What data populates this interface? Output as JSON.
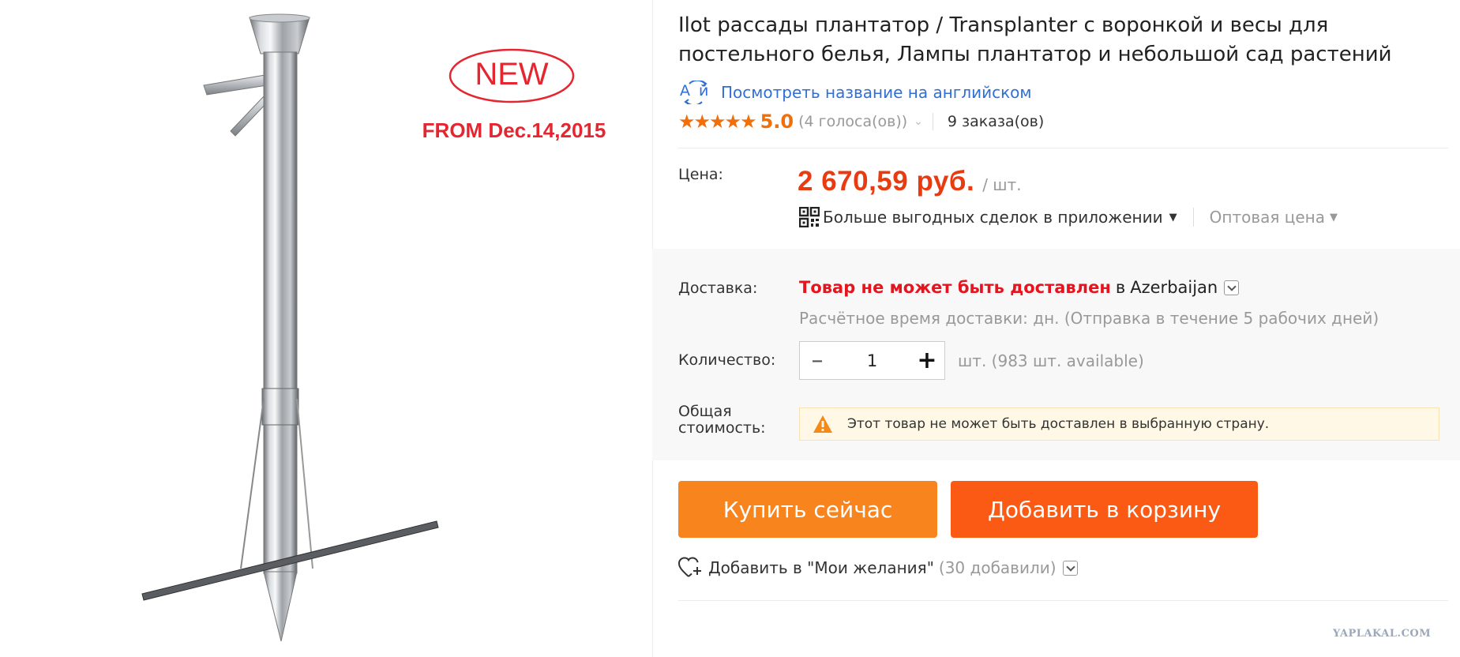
{
  "image": {
    "badge_new": "NEW",
    "badge_from": "FROM Dec.14,2015"
  },
  "product": {
    "title": "Ilot рассады плантатор / Transplanter с воронкой и весы для постельного белья, Лампы плантатор и небольшой сад растений",
    "translate_link": "Посмотреть название на английском",
    "translate_icon_text": "A",
    "translate_icon_text2": "й",
    "stars": "★★★★★",
    "rating": "5.0",
    "votes": "(4 голоса(ов))",
    "orders": "9 заказа(ов)"
  },
  "price": {
    "label": "Цена:",
    "value": "2 670,59 руб.",
    "unit": "/ шт.",
    "deals_text": "Больше выгодных сделок в приложении",
    "wholesale": "Оптовая цена"
  },
  "shipping": {
    "label": "Доставка:",
    "not_delivered": "Товар не может быть доставлен",
    "in_word": "в",
    "country": "Azerbaijan",
    "time_text": "Расчётное время доставки: дн. (Отправка в течение 5 рабочих дней)"
  },
  "quantity": {
    "label": "Количество:",
    "minus": "–",
    "value": "1",
    "plus": "+",
    "available": "шт. (983 шт. available)"
  },
  "total": {
    "label_line1": "Общая",
    "label_line2": "стоимость:",
    "warning": "Этот товар не может быть доставлен в выбранную страну."
  },
  "buttons": {
    "buy_now": "Купить сейчас",
    "add_to_cart": "Добавить в корзину"
  },
  "wishlist": {
    "text": "Добавить в \"Мои желания\"",
    "count": "(30 добавили)"
  },
  "watermark": "YAPLAKAL.COM",
  "colors": {
    "price_red": "#ea3b10",
    "rating_orange": "#f06f0a",
    "buy_orange": "#f7841c",
    "cart_orange": "#fa5a13",
    "link_blue": "#2f6fd6",
    "error_red": "#e6141e"
  }
}
